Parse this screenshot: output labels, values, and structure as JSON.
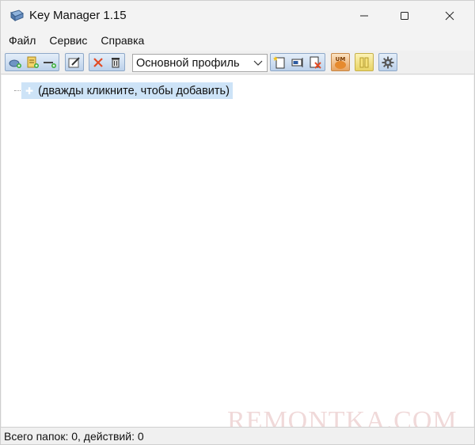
{
  "window": {
    "title": "Key Manager 1.15",
    "controls": {
      "minimize": "—",
      "maximize": "☐",
      "close": "✕"
    }
  },
  "menu": {
    "items": [
      "Файл",
      "Сервис",
      "Справка"
    ]
  },
  "toolbar": {
    "profile_value": "Основной профиль",
    "icons": [
      "add-folder-icon",
      "add-action-icon",
      "add-separator-icon",
      "edit-icon",
      "delete-icon",
      "clear-icon",
      "new-profile-icon",
      "rename-profile-icon",
      "delete-profile-icon",
      "um-icon",
      "pause-icon",
      "gear-icon"
    ]
  },
  "tree": {
    "placeholder": "(дважды кликните, чтобы добавить)"
  },
  "status": {
    "text": "Всего папок: 0, действий: 0"
  },
  "watermark": {
    "text": "REMONTKA.COM"
  },
  "colors": {
    "selection": "#cde3f7",
    "toolbar_button": "#bcd1ea",
    "um_button": "#e7a25f",
    "pause_button": "#e8d364"
  }
}
